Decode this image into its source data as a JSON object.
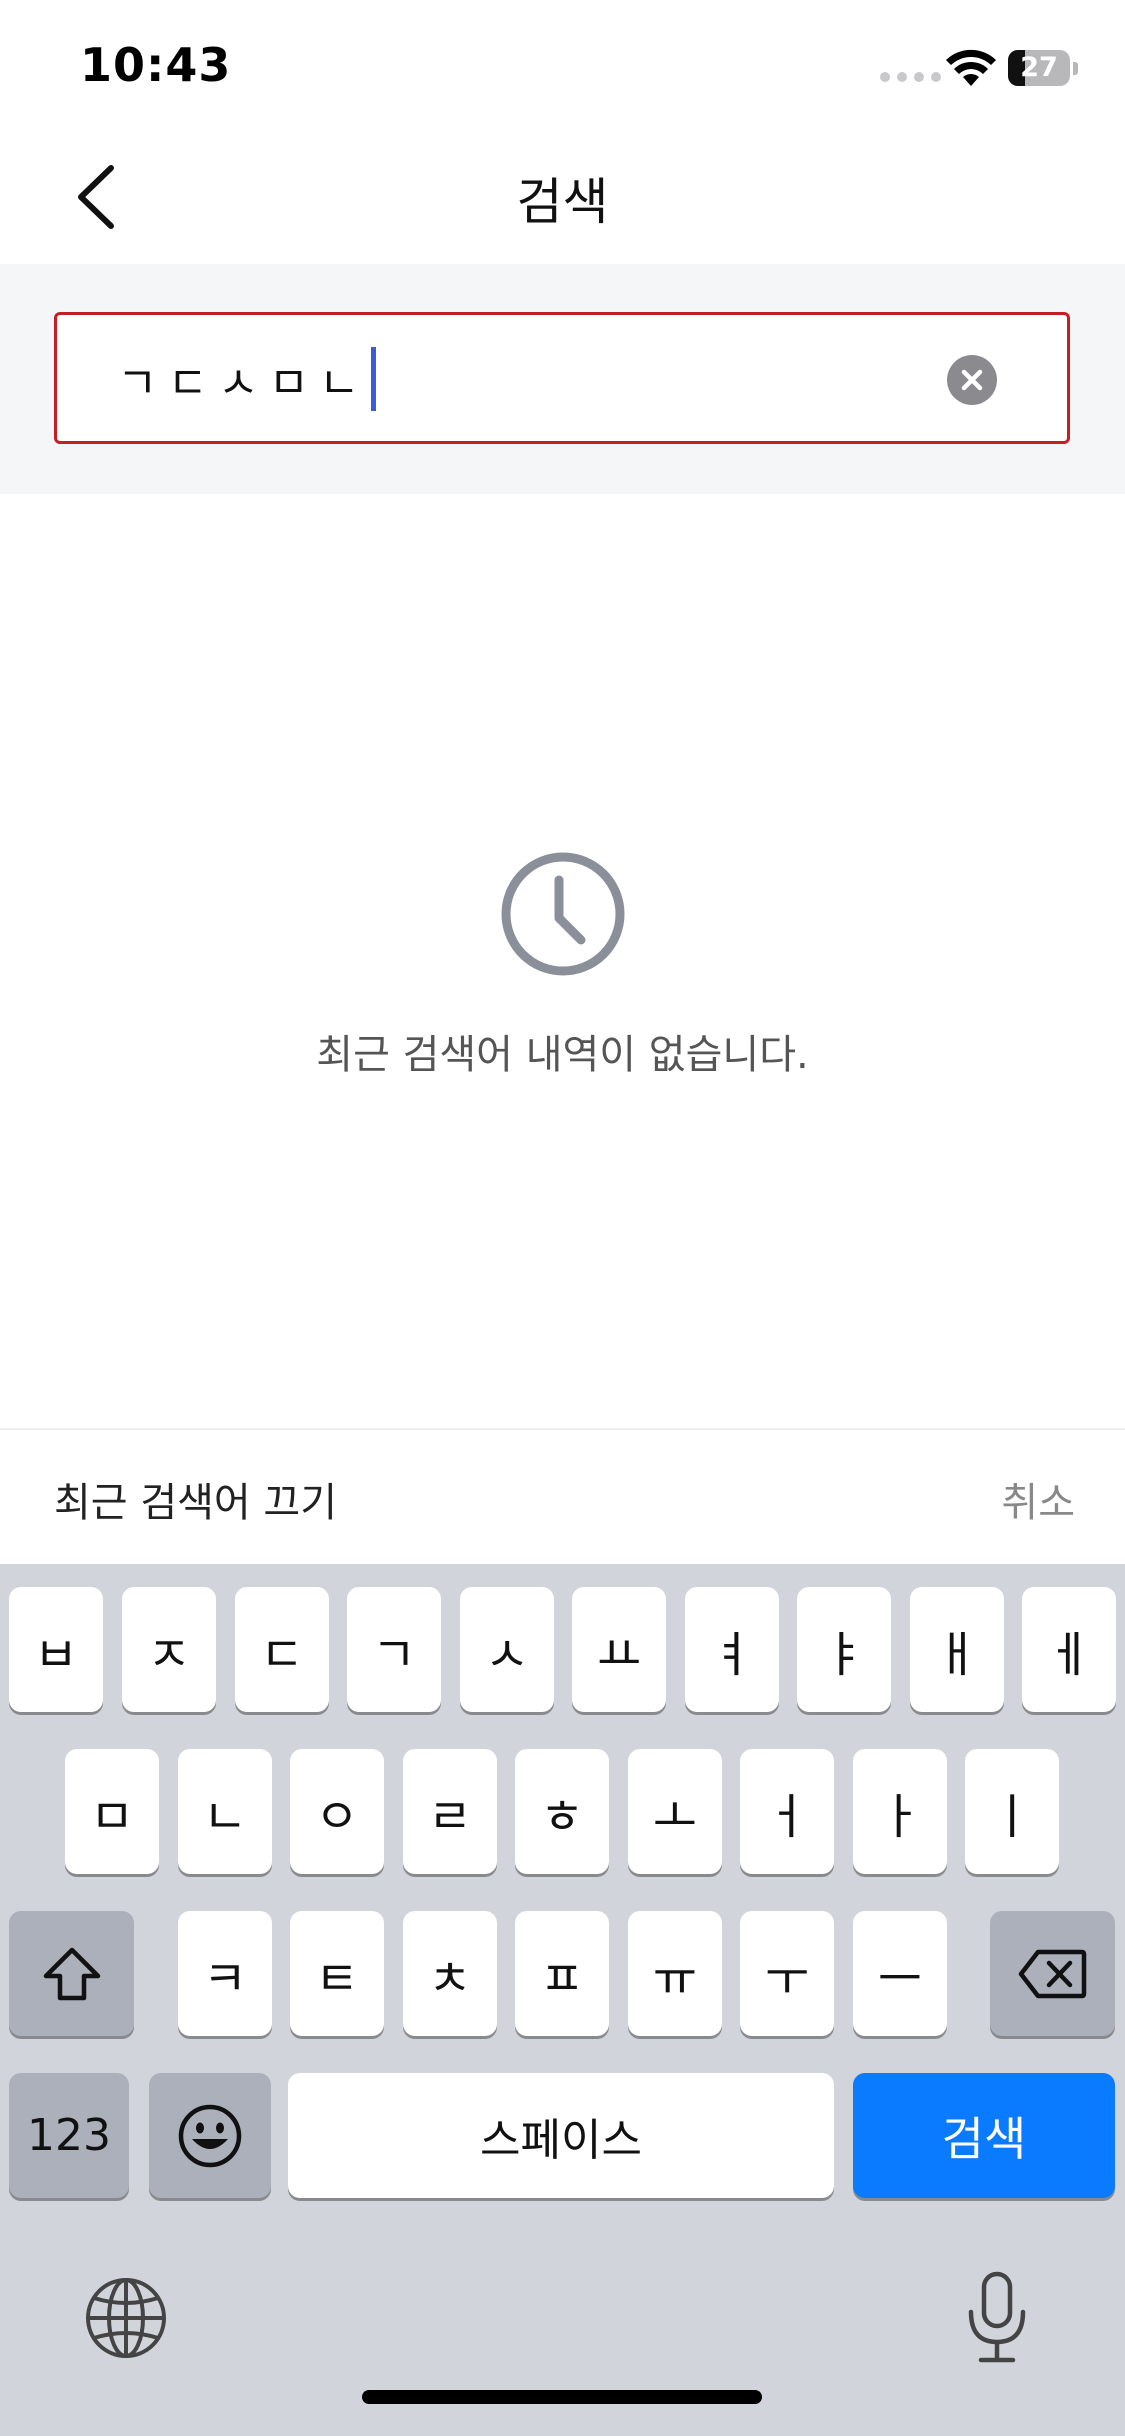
{
  "status_bar": {
    "time": "10:43",
    "battery": "27"
  },
  "nav": {
    "title": "검색"
  },
  "search": {
    "value": "ㄱㄷㅅㅁㄴ"
  },
  "empty_state": {
    "message": "최근 검색어 내역이 없습니다."
  },
  "recent_bar": {
    "toggle_label": "최근 검색어 끄기",
    "cancel_label": "취소"
  },
  "keyboard": {
    "row1": [
      "ㅂ",
      "ㅈ",
      "ㄷ",
      "ㄱ",
      "ㅅ",
      "ㅛ",
      "ㅕ",
      "ㅑ",
      "ㅐ",
      "ㅔ"
    ],
    "row2": [
      "ㅁ",
      "ㄴ",
      "ㅇ",
      "ㄹ",
      "ㅎ",
      "ㅗ",
      "ㅓ",
      "ㅏ",
      "ㅣ"
    ],
    "row3": [
      "ㅋ",
      "ㅌ",
      "ㅊ",
      "ㅍ",
      "ㅠ",
      "ㅜ",
      "ㅡ"
    ],
    "numbers_label": "123",
    "space_label": "스페이스",
    "search_label": "검색"
  },
  "colors": {
    "search_border": "#c41f23",
    "search_key": "#0a7aff",
    "caret": "#3b5bd9"
  },
  "icons": [
    "back-arrow-icon",
    "clear-icon",
    "clock-icon",
    "shift-icon",
    "backspace-icon",
    "emoji-icon",
    "globe-icon",
    "microphone-icon",
    "wifi-icon"
  ]
}
